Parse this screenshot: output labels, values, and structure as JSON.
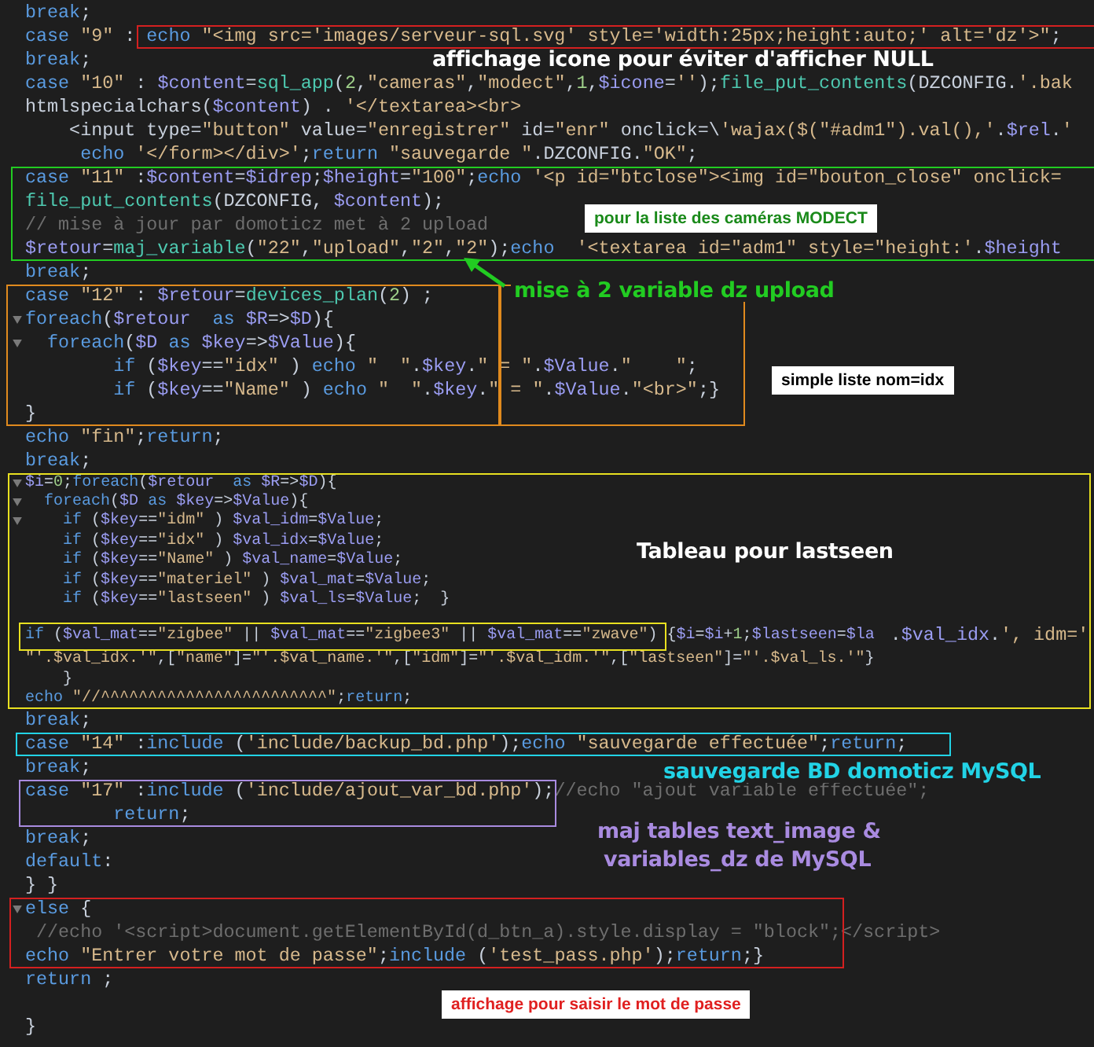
{
  "code_lines": [
    {
      "text": "break;",
      "kind": "normal"
    },
    {
      "text": "case \"9\" : echo \"<img src='images/serveur-sql.svg' style='width:25px;height:auto;' alt='dz'>\";",
      "kind": "normal"
    },
    {
      "text": "break;",
      "kind": "normal"
    },
    {
      "text": "case \"10\" : $content=sql_app(2,\"cameras\",\"modect\",1,$icone='');file_put_contents(DZCONFIG.'.bak",
      "kind": "normal"
    },
    {
      "text": "htmlspecialchars($content) . '</textarea><br>",
      "kind": "normal"
    },
    {
      "text": "    <input type=\"button\" value=\"enregistrer\" id=\"enr\" onclick=\\'wajax($(\"#adm1\").val(),'.$rel.'",
      "kind": "normal"
    },
    {
      "text": "     echo '</form></div>';return \"sauvegarde \".DZCONFIG.\"OK\";",
      "kind": "normal"
    },
    {
      "text": "case \"11\" :$content=$idrep;$height=\"100\";echo '<p id=\"btclose\"><img id=\"bouton_close\" onclick=",
      "kind": "normal"
    },
    {
      "text": "file_put_contents(DZCONFIG, $content);",
      "kind": "normal"
    },
    {
      "text": "// mise à jour par domoticz met à 2 upload",
      "kind": "normal"
    },
    {
      "text": "$retour=maj_variable(\"22\",\"upload\",\"2\",\"2\");echo  '<textarea id=\"adm1\" style=\"height:'.$height",
      "kind": "normal"
    },
    {
      "text": "break;",
      "kind": "normal"
    },
    {
      "text": "case \"12\" : $retour=devices_plan(2) ;",
      "kind": "normal"
    },
    {
      "text": "foreach($retour  as $R=>$D){",
      "kind": "normal",
      "fold": true
    },
    {
      "text": "  foreach($D as $key=>$Value){",
      "kind": "normal",
      "fold": true
    },
    {
      "text": "        if ($key==\"idx\" ) echo \"  \".$key.\" = \".$Value.\"    \";",
      "kind": "normal"
    },
    {
      "text": "        if ($key==\"Name\" ) echo \"  \".$key.\" = \".$Value.\"<br>\";}",
      "kind": "normal"
    },
    {
      "text": "}",
      "kind": "normal"
    },
    {
      "text": "echo \"fin\";return;",
      "kind": "normal"
    },
    {
      "text": "break;",
      "kind": "normal"
    },
    {
      "text": "$i=0;foreach($retour  as $R=>$D){",
      "kind": "compact",
      "fold": true
    },
    {
      "text": "  foreach($D as $key=>$Value){",
      "kind": "compact",
      "fold": true
    },
    {
      "text": "    if ($key==\"idm\" ) $val_idm=$Value;",
      "kind": "compact",
      "fold": true
    },
    {
      "text": "    if ($key==\"idx\" ) $val_idx=$Value;",
      "kind": "compact"
    },
    {
      "text": "    if ($key==\"Name\" ) $val_name=$Value;",
      "kind": "compact"
    },
    {
      "text": "    if ($key==\"materiel\" ) $val_mat=$Value;",
      "kind": "compact"
    },
    {
      "text": "    if ($key==\"lastseen\" ) $val_ls=$Value;  }",
      "kind": "compact"
    },
    {
      "kind": "compact"
    },
    {
      "text": "if ($val_mat==\"zigbee\" || $val_mat==\"zigbee3\" || $val_mat==\"zwave\") {$i=$i+1;$lastseen=$la",
      "kind": "compact",
      "continuation": ".$val_idx.', idm='"
    },
    {
      "text": "\"'.$val_idx.'\",[\"name\"]=\"'.$val_name.'\",[\"idm\"]=\"'.$val_idm.'\",[\"lastseen\"]=\"'.$val_ls.'\"}",
      "kind": "compact"
    },
    {
      "text": "    }",
      "kind": "compact"
    },
    {
      "text": "echo \"//^^^^^^^^^^^^^^^^^^^^^^^^\";return;",
      "kind": "compact"
    },
    {
      "text": "break;",
      "kind": "normal"
    },
    {
      "text": "case \"14\" :include ('include/backup_bd.php');echo \"sauvegarde effectuée\";return;",
      "kind": "normal"
    },
    {
      "text": "break;",
      "kind": "normal"
    },
    {
      "text": "case \"17\" :include ('include/ajout_var_bd.php');//echo \"ajout variable effectuée\";",
      "kind": "normal"
    },
    {
      "text": "        return;",
      "kind": "normal"
    },
    {
      "text": "break;",
      "kind": "normal"
    },
    {
      "text": "default:",
      "kind": "normal"
    },
    {
      "text": "} }",
      "kind": "normal"
    },
    {
      "text": "else {",
      "kind": "normal",
      "fold": true
    },
    {
      "text": " //echo '<script>document.getElementById(d_btn_a).style.display = \"block\";</script>",
      "kind": "normal"
    },
    {
      "text": "echo \"Entrer votre mot de passe\";include ('test_pass.php');return;}",
      "kind": "normal"
    },
    {
      "text": "return ;",
      "kind": "normal"
    },
    {
      "kind": "normal"
    },
    {
      "text": "}",
      "kind": "normal"
    }
  ],
  "highlight_frames": [
    {
      "color": "#d42020"
    },
    {
      "color": "#22cc22"
    },
    {
      "color": "#e08a1e"
    },
    {
      "color": "#e08a1e"
    },
    {
      "color": "#e8e020"
    },
    {
      "color": "#e8e020"
    },
    {
      "color": "#22d3e6"
    },
    {
      "color": "#a98be0"
    },
    {
      "color": "#d42020"
    }
  ],
  "annotations": [
    {
      "text": "affichage icone pour éviter d'afficher NULL",
      "kind": "caption",
      "color": "#ffffff"
    },
    {
      "text": "pour la liste des caméras MODECT",
      "kind": "tag",
      "color": "#1a8a1a"
    },
    {
      "text": "mise à 2 variable dz upload",
      "kind": "caption",
      "color": "#22cc22"
    },
    {
      "text": "simple liste nom=idx",
      "kind": "tag",
      "color": "#000000"
    },
    {
      "text": "Tableau pour lastseen",
      "kind": "caption",
      "color": "#ffffff"
    },
    {
      "text": "sauvegarde BD domoticz MySQL",
      "kind": "caption",
      "color": "#22d3e6"
    },
    {
      "text": "maj tables text_image &",
      "kind": "caption",
      "color": "#a98be0"
    },
    {
      "text": "variables_dz de MySQL",
      "kind": "caption",
      "color": "#a98be0"
    },
    {
      "text": "affichage pour saisir le mot de passe",
      "kind": "tag",
      "color": "#e02020"
    }
  ]
}
